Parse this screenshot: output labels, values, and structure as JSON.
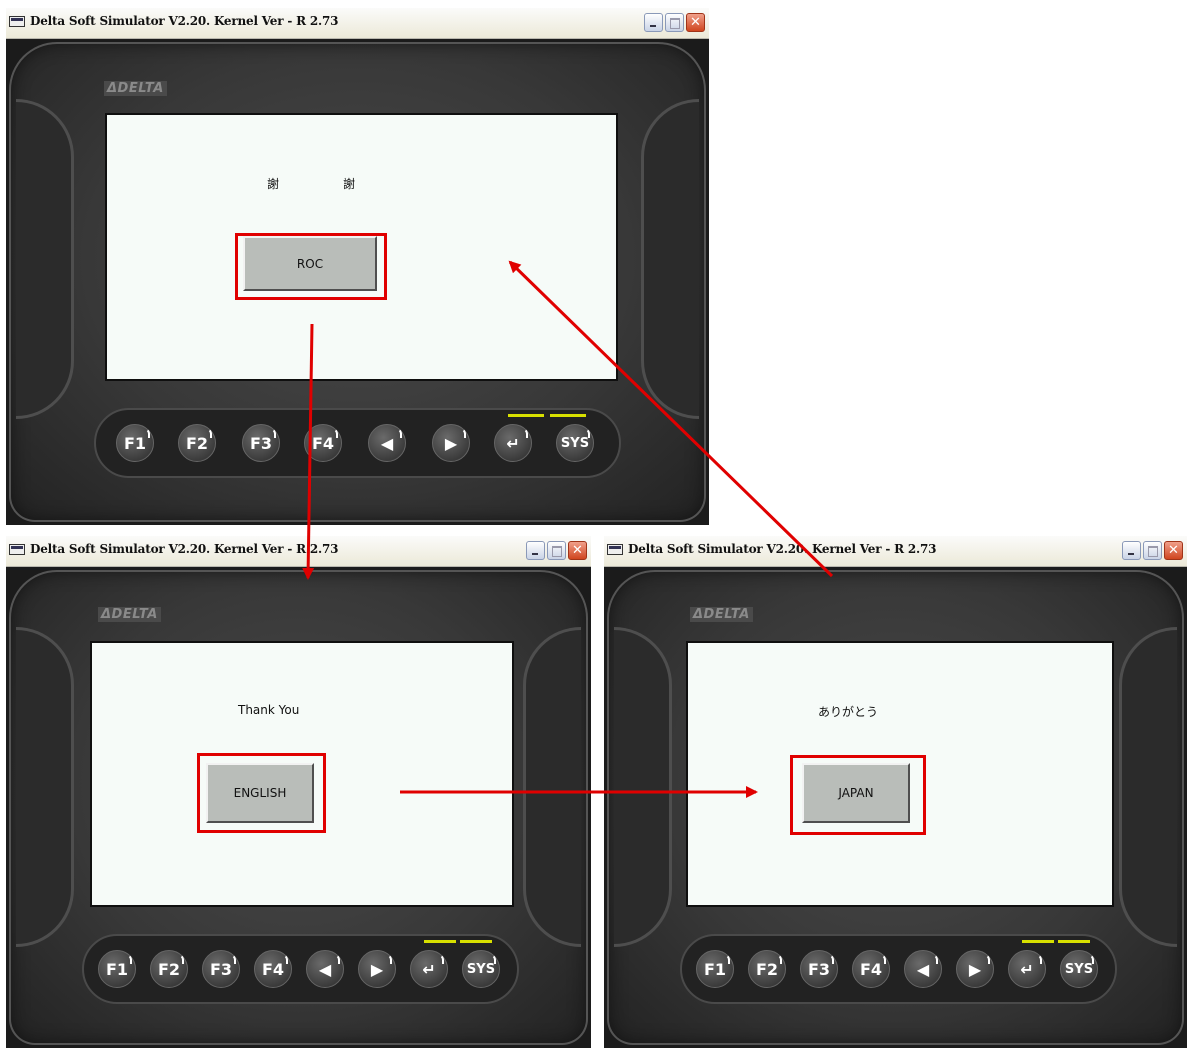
{
  "window_title": "Delta Soft Simulator V2.20. Kernel Ver - R 2.73",
  "title_buttons": {
    "close": "✕"
  },
  "logo_text": "ΔDELTA",
  "keys": [
    "F1",
    "F2",
    "F3",
    "F4",
    "◀",
    "▶",
    "↵",
    "SYS"
  ],
  "screens": {
    "roc": {
      "caption_left": "謝",
      "caption_right": "謝",
      "button_label": "ROC"
    },
    "english": {
      "caption": "Thank You",
      "button_label": "ENGLISH"
    },
    "japan": {
      "caption": "ありがとう",
      "button_label": "JAPAN"
    }
  },
  "colors": {
    "highlight": "#e00000",
    "led": "#d8e000",
    "screen_bg": "#f6fbf8"
  }
}
